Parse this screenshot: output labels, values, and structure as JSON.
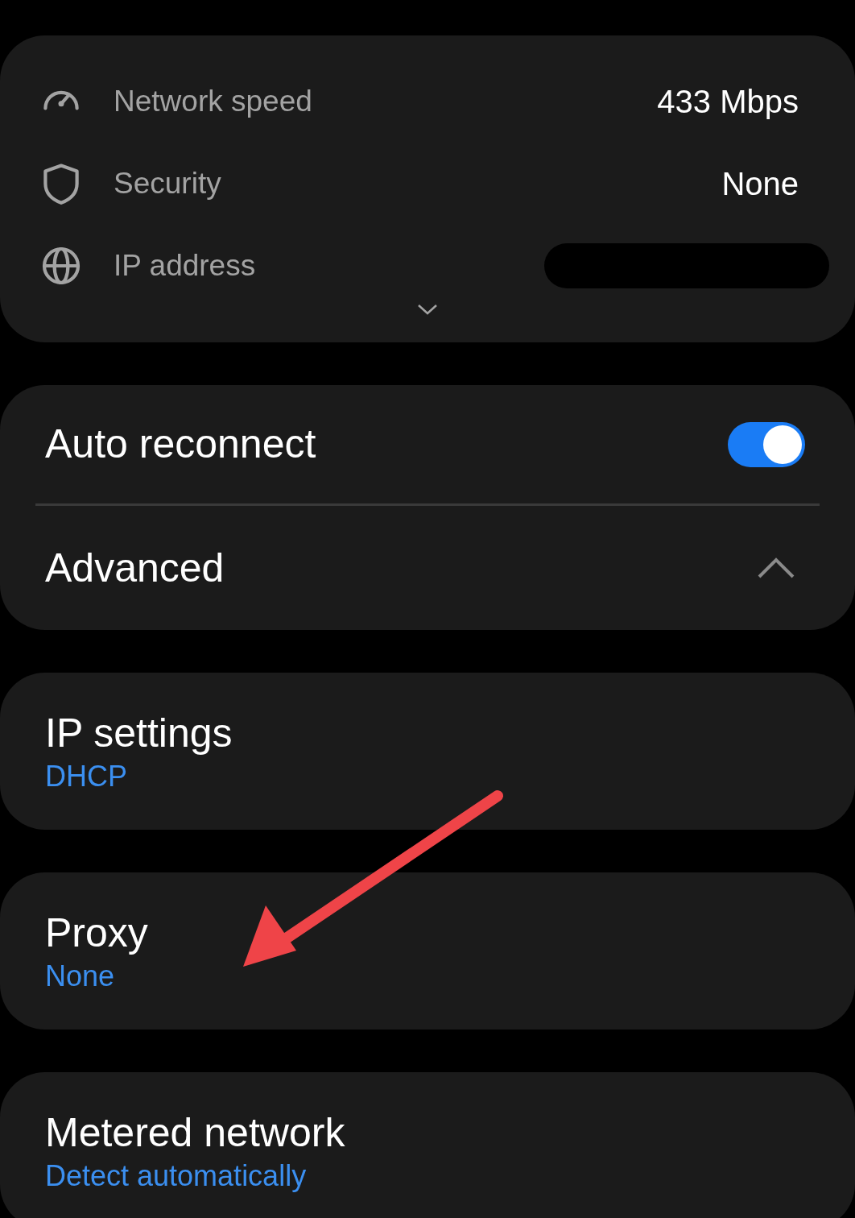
{
  "details": [
    {
      "kind": "speed",
      "label": "Network speed",
      "value": "433 Mbps"
    },
    {
      "kind": "security",
      "label": "Security",
      "value": "None"
    },
    {
      "kind": "ip",
      "label": "IP address",
      "redacted": true
    }
  ],
  "details_expanded": false,
  "auto_reconnect": {
    "label": "Auto reconnect",
    "on": true
  },
  "advanced": {
    "label": "Advanced",
    "expanded": true
  },
  "settings": [
    {
      "title": "IP settings",
      "value": "DHCP"
    },
    {
      "title": "Proxy",
      "value": "None"
    },
    {
      "title": "Metered network",
      "value": "Detect automatically"
    }
  ],
  "annotation": {
    "kind": "arrow"
  }
}
